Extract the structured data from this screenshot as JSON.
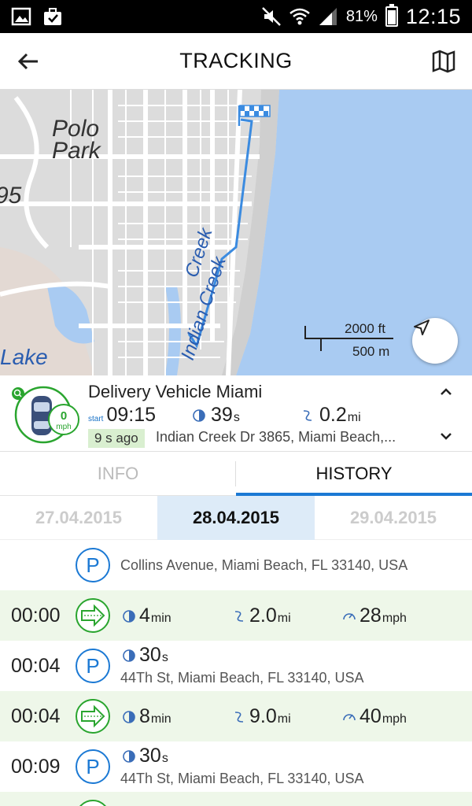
{
  "status_bar": {
    "battery": "81%",
    "time": "12:15"
  },
  "app_bar": {
    "title": "TRACKING"
  },
  "map": {
    "labels": {
      "park": "Polo Park",
      "highway": "95",
      "lake": "Lake",
      "creek": "Indian Creek"
    },
    "scale": {
      "imperial": "2000 ft",
      "metric": "500 m"
    },
    "colors": {
      "water": "#a9cbf2",
      "route": "#3b8be0",
      "land": "#dcdcdc"
    }
  },
  "vehicle": {
    "name": "Delivery Vehicle Miami",
    "speed_value": "0",
    "speed_unit": "mph",
    "start_label": "start",
    "start_time": "09:15",
    "idle_value": "39",
    "idle_unit": "s",
    "distance_value": "0.2",
    "distance_unit": "mi",
    "last_update": "9 s ago",
    "address": "Indian Creek Dr 3865, Miami Beach,..."
  },
  "tabs": {
    "info": "INFO",
    "history": "HISTORY",
    "active": "HISTORY"
  },
  "dates": {
    "prev": "27.04.2015",
    "current": "28.04.2015",
    "next": "29.04.2015"
  },
  "history": [
    {
      "type": "park",
      "time": "",
      "address": "Collins Avenue, Miami Beach, FL 33140, USA"
    },
    {
      "type": "drive",
      "time": "00:00",
      "duration_value": "4",
      "duration_unit": "min",
      "distance_value": "2.0",
      "distance_unit": "mi",
      "speed_value": "28",
      "speed_unit": "mph"
    },
    {
      "type": "park",
      "time": "00:04",
      "duration_value": "30",
      "duration_unit": "s",
      "address": "44Th St, Miami Beach, FL 33140, USA"
    },
    {
      "type": "drive",
      "time": "00:04",
      "duration_value": "8",
      "duration_unit": "min",
      "distance_value": "9.0",
      "distance_unit": "mi",
      "speed_value": "40",
      "speed_unit": "mph"
    },
    {
      "type": "park",
      "time": "00:09",
      "duration_value": "30",
      "duration_unit": "s",
      "address": "44Th St, Miami Beach, FL 33140, USA"
    }
  ],
  "icons": {
    "back": "arrow-left-icon",
    "map": "map-icon",
    "locate": "navigation-arrow-icon",
    "parking": "parking-icon",
    "drive": "drive-arrow-icon",
    "clock": "clock-icon",
    "distance": "route-icon",
    "speed": "speedometer-icon"
  },
  "accent": "#1b79d4",
  "green": "#2aa52f"
}
